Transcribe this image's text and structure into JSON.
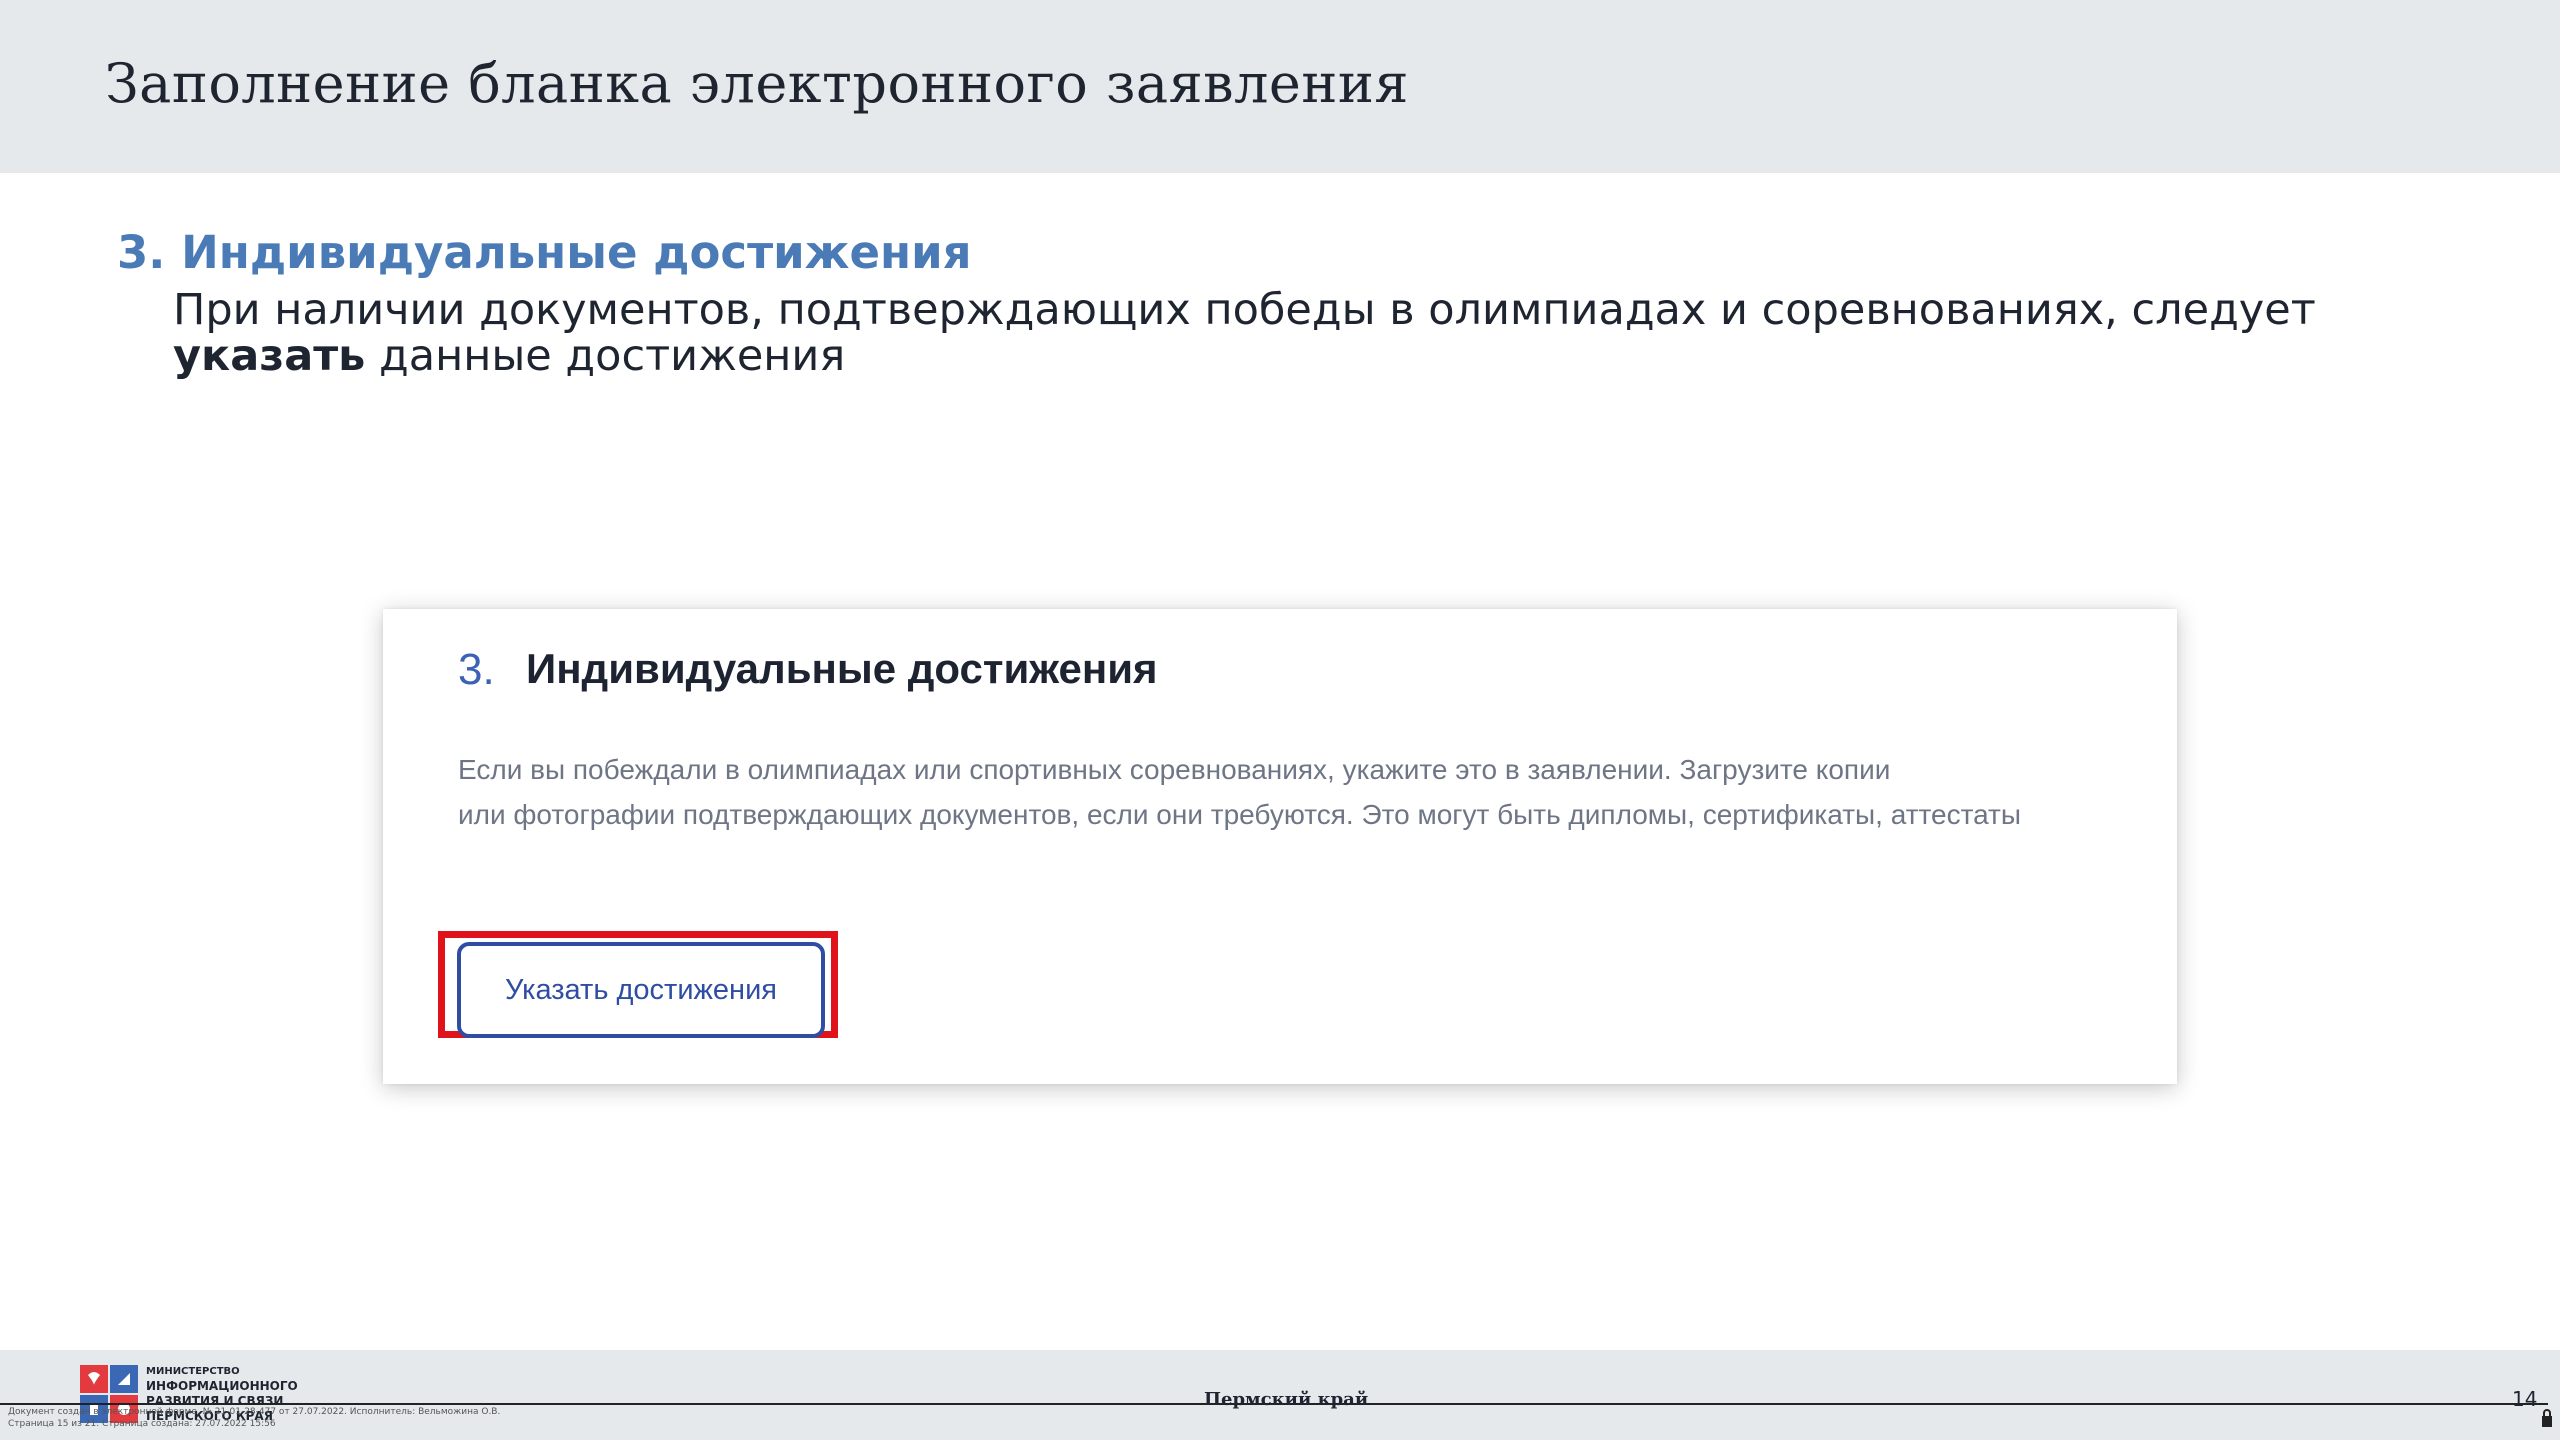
{
  "slide": {
    "title": "Заполнение бланка электронного заявления",
    "section_heading": "3. Индивидуальные достижения",
    "section_text_before": "При наличии документов, подтверждающих победы в олимпиадах и соревнованиях, следует ",
    "section_text_bold": "указать",
    "section_text_after": " данные достижения"
  },
  "card": {
    "number": "3.",
    "title": "Индивидуальные достижения",
    "description_line1": "Если вы побеждали в олимпиадах или спортивных соревнованиях, укажите это в заявлении. Загрузите копии",
    "description_line2": "или фотографии подтверждающих документов, если они требуются. Это могут быть дипломы, сертификаты, аттестаты",
    "button_label": "Указать достижения",
    "highlight_color": "#e0121b",
    "accent_color": "#2f4ea3"
  },
  "footer": {
    "ministry_line1": "МИНИСТЕРСТВО",
    "ministry_line2": "ИНФОРМАЦИОННОГО",
    "ministry_line3": "РАЗВИТИЯ И СВЯЗИ",
    "ministry_line4": "ПЕРМСКОГО КРАЯ",
    "doc_note_line1": "Документ создан в электронной форме. № 21-01-28-477 от 27.07.2022. Исполнитель: Вельможина О.В.",
    "doc_note_line2": "Страница 15 из 21. Страница создана: 27.07.2022 15:56",
    "region": "Пермский край",
    "page_number": "14",
    "logo_icon": "ministry-logo",
    "lock_icon": "lock-icon"
  }
}
